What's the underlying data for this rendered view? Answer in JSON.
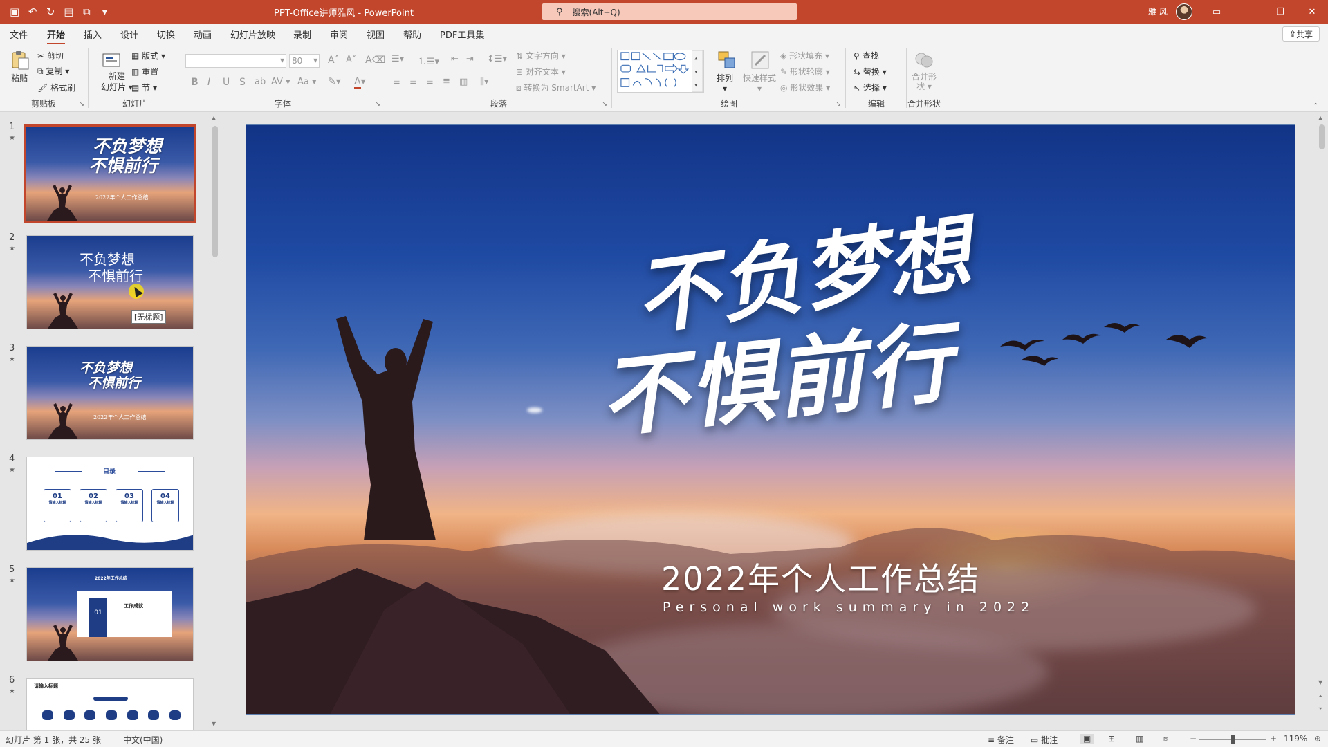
{
  "window": {
    "title": "PPT-Office讲师雅风  -  PowerPoint",
    "search_placeholder": "搜索(Alt+Q)",
    "user": "雅 风",
    "accent": "#c1462c"
  },
  "qat": [
    "save-icon",
    "undo-icon",
    "redo-icon",
    "start-from-beginning-icon",
    "customize-icon"
  ],
  "menu": {
    "tabs": [
      "文件",
      "开始",
      "插入",
      "设计",
      "切换",
      "动画",
      "幻灯片放映",
      "录制",
      "审阅",
      "视图",
      "帮助",
      "PDF工具集"
    ],
    "active": "开始",
    "share": "共享"
  },
  "ribbon": {
    "clipboard": {
      "label": "剪贴板",
      "paste": "粘贴",
      "cut": "剪切",
      "copy": "复制",
      "format_painter": "格式刷"
    },
    "slides": {
      "label": "幻灯片",
      "new_slide": "新建",
      "new_slide2": "幻灯片",
      "layout": "版式",
      "reset": "重置",
      "section": "节"
    },
    "font": {
      "label": "字体",
      "font_size": "80"
    },
    "paragraph": {
      "label": "段落",
      "text_direction": "文字方向",
      "align_text": "对齐文本",
      "smartart": "转换为 SmartArt"
    },
    "drawing": {
      "label": "绘图",
      "arrange": "排列",
      "quick_styles": "快速样式",
      "shape_fill": "形状填充",
      "shape_outline": "形状轮廓",
      "shape_effects": "形状效果"
    },
    "editing": {
      "label": "编辑",
      "find": "查找",
      "replace": "替换",
      "select": "选择"
    },
    "merge": {
      "label": "合并形状",
      "merge_shapes": "合并形",
      "merge_shapes2": "状"
    }
  },
  "thumbnails": [
    {
      "num": "1",
      "selected": true,
      "title1": "不负梦想",
      "title2": "不惧前行",
      "subtitle": "2022年个人工作总结"
    },
    {
      "num": "2",
      "selected": false,
      "title1": "不负梦想",
      "title2": "不惧前行"
    },
    {
      "num": "3",
      "selected": false,
      "title1": "不负梦想",
      "title2": "不惧前行",
      "subtitle": "2022年个人工作总结"
    },
    {
      "num": "4",
      "selected": false,
      "heading": "目录",
      "items": [
        "01",
        "02",
        "03",
        "04"
      ],
      "item_label": "请输入标题"
    },
    {
      "num": "5",
      "selected": false,
      "heading": "2022年工作总结",
      "num_label": "01",
      "card_title": "工作成就"
    },
    {
      "num": "6",
      "selected": false,
      "heading": "请输入标题"
    }
  ],
  "tooltip": "[无标题]",
  "slide": {
    "title_line1": "不负梦想",
    "title_line2": "不惧前行",
    "subtitle": "2022年个人工作总结",
    "english": "Personal work summary in 2022"
  },
  "status": {
    "slide_info": "幻灯片 第 1 张，共 25 张",
    "language": "中文(中国)",
    "notes": "备注",
    "comments": "批注",
    "zoom": "119%"
  }
}
